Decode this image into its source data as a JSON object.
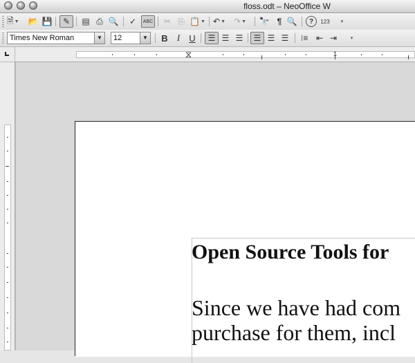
{
  "window": {
    "title": "floss.odt – NeoOffice W"
  },
  "standard_toolbar": {
    "buttons": [
      {
        "name": "new-document",
        "glyph": "🗎"
      },
      {
        "name": "open",
        "glyph": "📂"
      },
      {
        "name": "save",
        "glyph": "💾"
      },
      {
        "name": "edit-file",
        "glyph": "✎"
      },
      {
        "name": "export-pdf",
        "glyph": "▤"
      },
      {
        "name": "print",
        "glyph": "⎙"
      },
      {
        "name": "page-preview",
        "glyph": "🔍"
      },
      {
        "name": "spellcheck",
        "glyph": "✓"
      },
      {
        "name": "autospellcheck",
        "glyph": "ABC"
      },
      {
        "name": "cut",
        "glyph": "✂"
      },
      {
        "name": "copy",
        "glyph": "⎘"
      },
      {
        "name": "paste",
        "glyph": "📋"
      },
      {
        "name": "undo",
        "glyph": "↶"
      },
      {
        "name": "redo",
        "glyph": "↷"
      },
      {
        "name": "find-replace",
        "glyph": "🔭"
      },
      {
        "name": "formatting-marks",
        "glyph": "¶"
      },
      {
        "name": "zoom",
        "glyph": "🔍"
      },
      {
        "name": "help",
        "glyph": "?"
      },
      {
        "name": "numbers",
        "glyph": "123"
      }
    ]
  },
  "formatting_toolbar": {
    "font_name": "Times New Roman",
    "font_size": "12",
    "bold": "B",
    "italic": "I",
    "underline": "U"
  },
  "ruler": {
    "label_1": "1"
  },
  "document": {
    "heading": "Open Source Tools for",
    "body_line_1": "Since we have had com",
    "body_line_2": "purchase for them, incl"
  }
}
